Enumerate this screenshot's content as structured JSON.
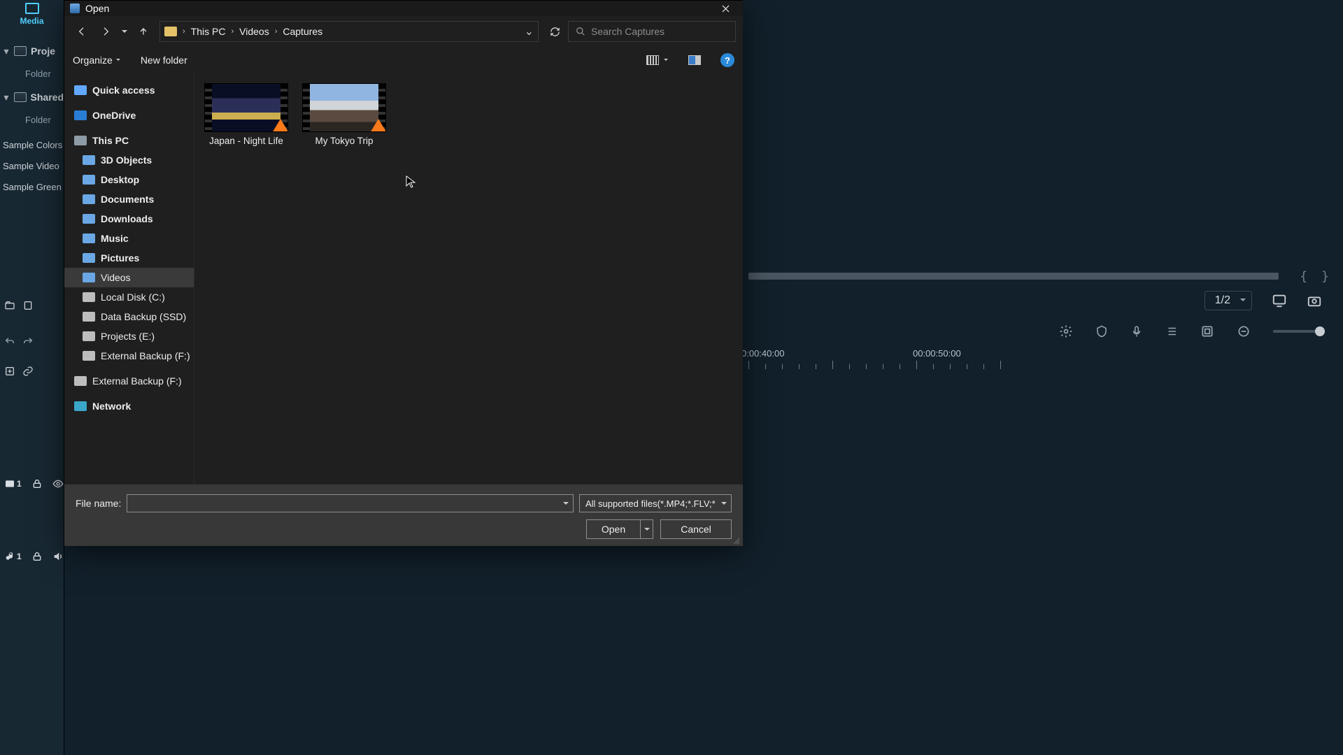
{
  "editor": {
    "media_tab": "Media",
    "tree": {
      "proje": "Proje",
      "shared": "Shared",
      "folder": "Folder"
    },
    "panel_items": [
      "Sample Colors",
      "Sample Video",
      "Sample Green"
    ],
    "page_indicator": "1/2",
    "timeline": {
      "t40": "0:00:40:00",
      "t50": "00:00:50:00"
    }
  },
  "dialog": {
    "title": "Open",
    "breadcrumb": [
      "This PC",
      "Videos",
      "Captures"
    ],
    "search_placeholder": "Search Captures",
    "toolbar": {
      "organize": "Organize",
      "new_folder": "New folder"
    },
    "navpane": {
      "quick_access": "Quick access",
      "onedrive": "OneDrive",
      "this_pc": "This PC",
      "children": [
        "3D Objects",
        "Desktop",
        "Documents",
        "Downloads",
        "Music",
        "Pictures",
        "Videos",
        "Local Disk (C:)",
        "Data Backup (SSD)",
        "Projects (E:)",
        "External Backup (F:)"
      ],
      "ext2": "External Backup (F:)",
      "network": "Network"
    },
    "files": [
      {
        "name": "Japan - Night Life",
        "thumb": "night"
      },
      {
        "name": "My Tokyo Trip",
        "thumb": "tokyo"
      }
    ],
    "footer": {
      "filename_label": "File name:",
      "filetype": "All supported files(*.MP4;*.FLV;*",
      "open": "Open",
      "cancel": "Cancel"
    }
  }
}
